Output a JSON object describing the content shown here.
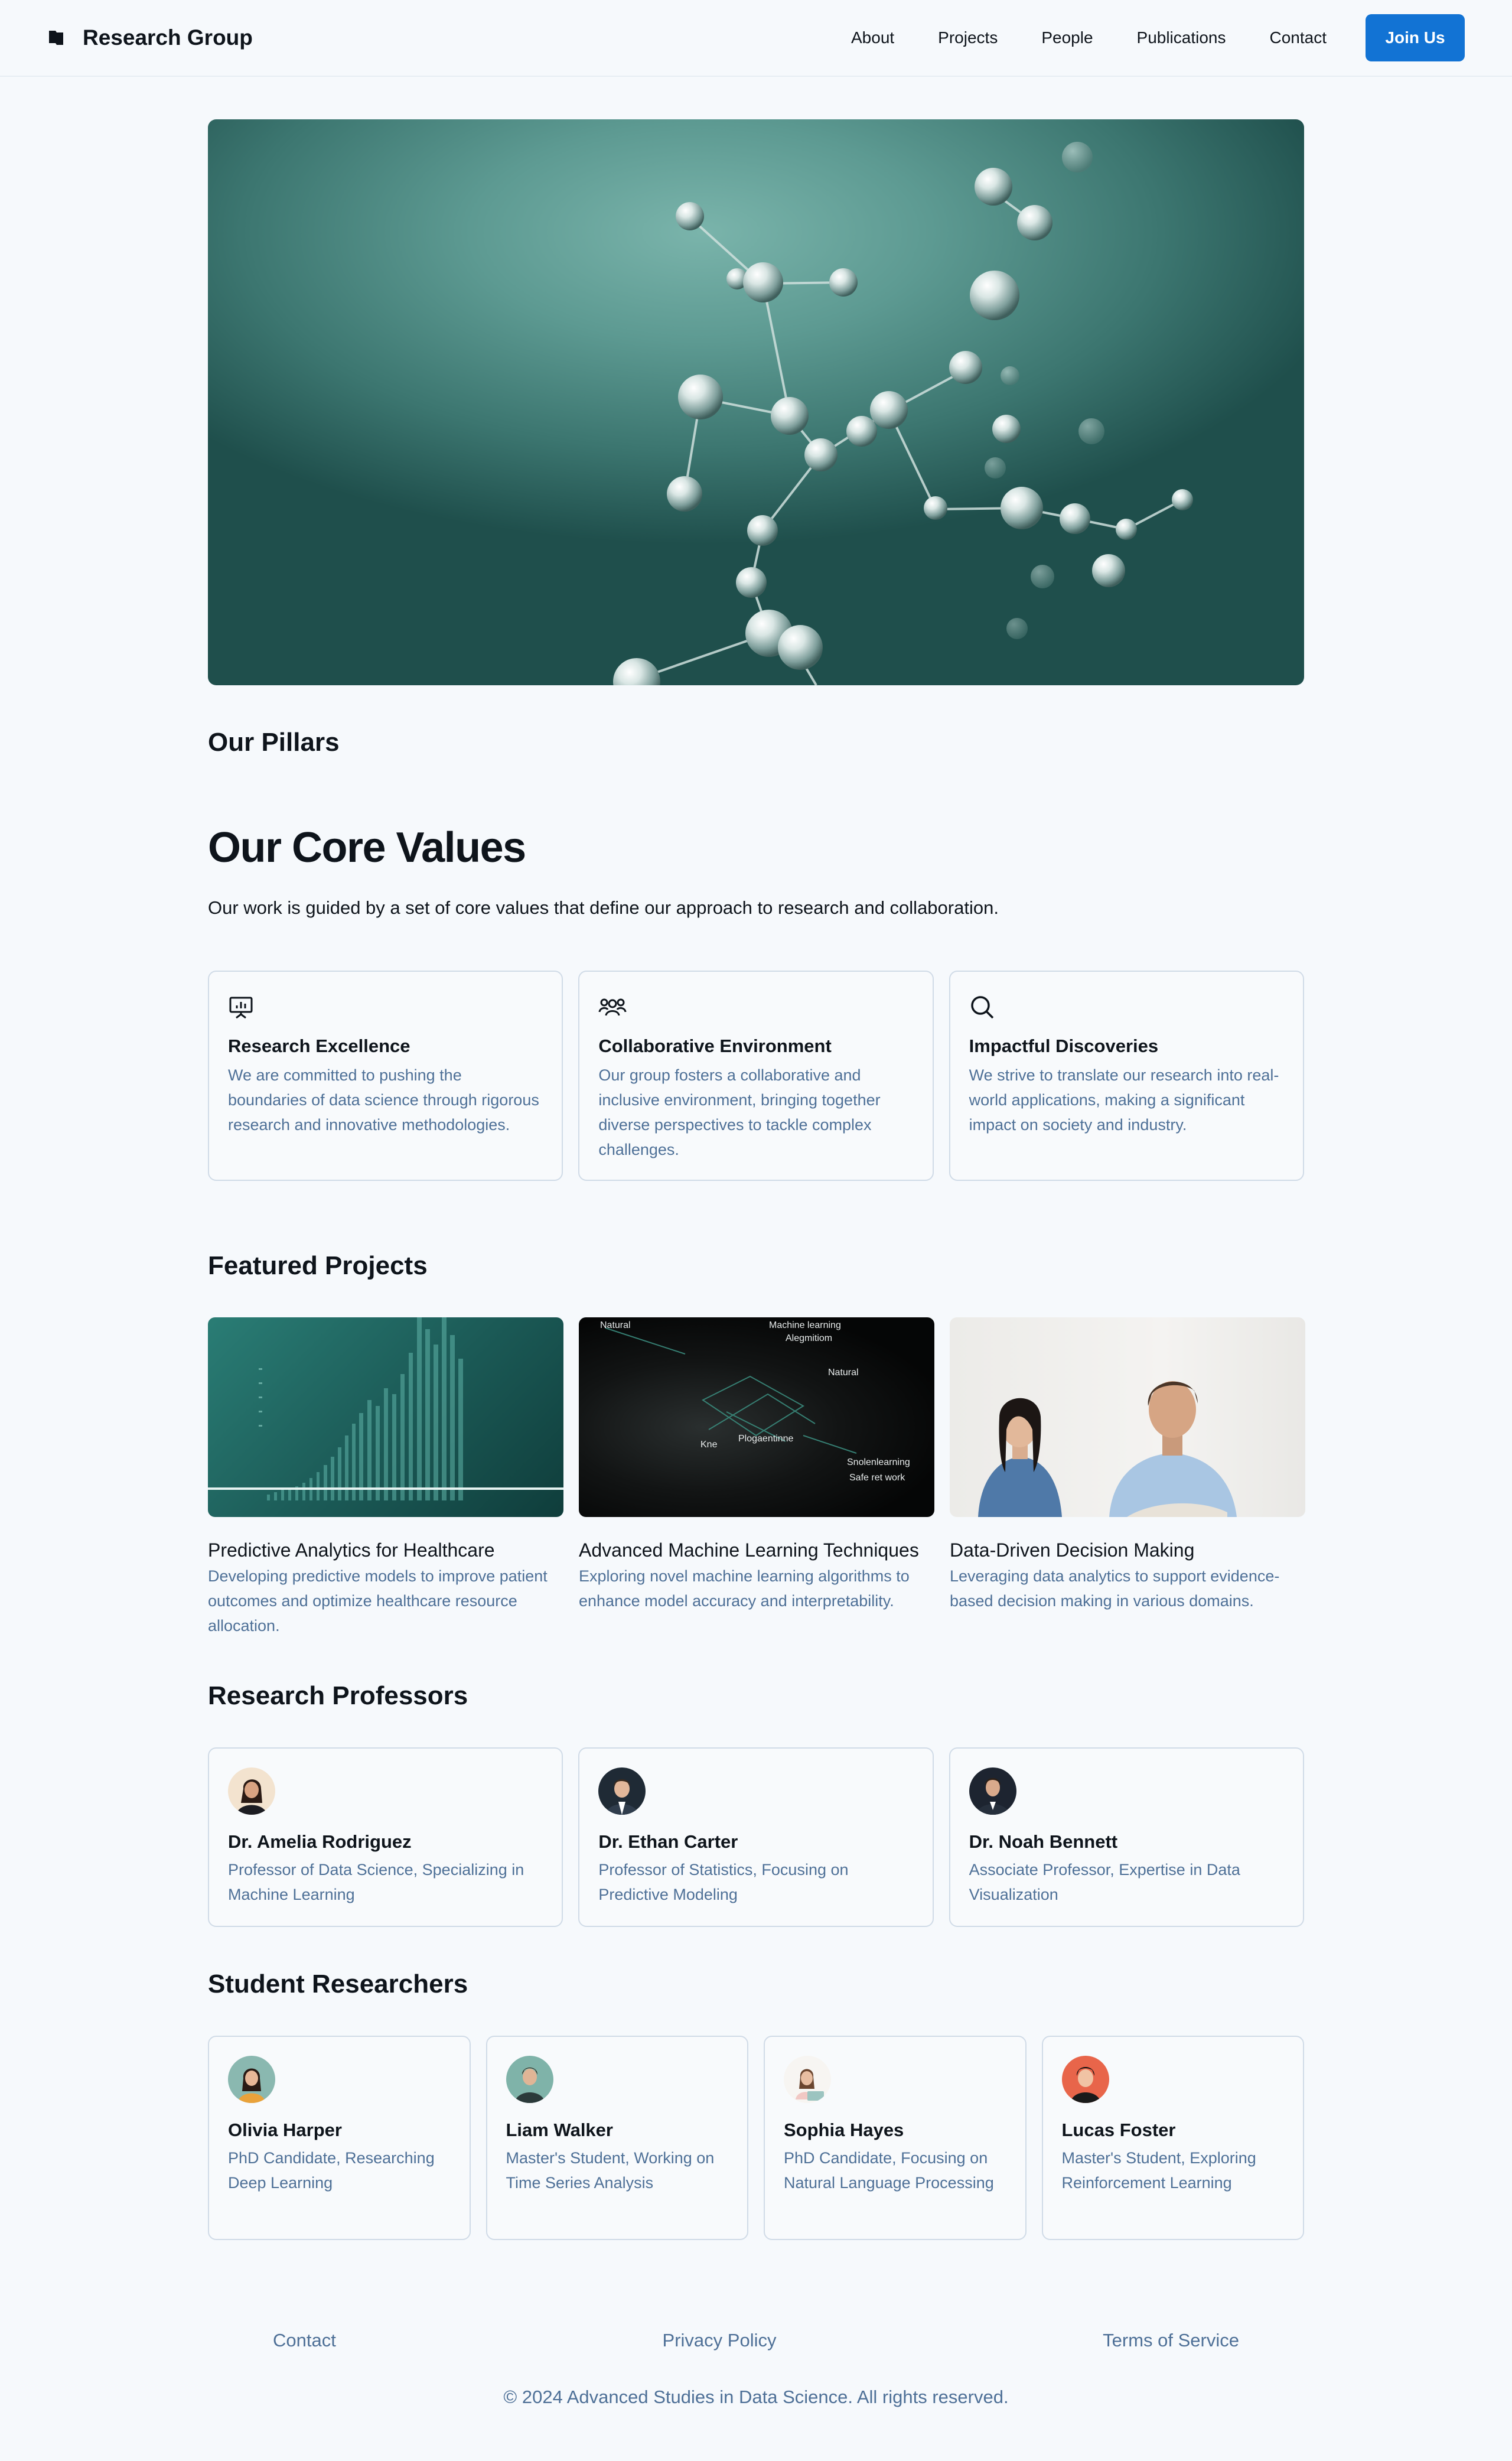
{
  "header": {
    "brand": "Research Group",
    "nav": [
      "About",
      "Projects",
      "People",
      "Publications",
      "Contact"
    ],
    "cta": "Join Us",
    "accent": "#1273d4"
  },
  "pillars": {
    "title": "Our Pillars"
  },
  "core_values": {
    "title": "Our Core Values",
    "description": "Our work is guided by a set of core values that define our approach to research and collaboration.",
    "cards": [
      {
        "icon": "presentation-chart-icon",
        "title": "Research Excellence",
        "text": "We are committed to pushing the boundaries of data science through rigorous research and innovative methodologies."
      },
      {
        "icon": "users-icon",
        "title": "Collaborative Environment",
        "text": "Our group fosters a collaborative and inclusive environment, bringing together diverse perspectives to tackle complex challenges."
      },
      {
        "icon": "magnifying-glass-icon",
        "title": "Impactful Discoveries",
        "text": "We strive to translate our research into real-world applications, making a significant impact on society and industry."
      }
    ]
  },
  "projects": {
    "title": "Featured Projects",
    "items": [
      {
        "title": "Predictive Analytics for Healthcare",
        "text": "Developing predictive models to improve patient outcomes and optimize healthcare resource allocation."
      },
      {
        "title": "Advanced Machine Learning Techniques",
        "text": "Exploring novel machine learning algorithms to enhance model accuracy and interpretability.",
        "image_labels": [
          "Natural",
          "Machine learning",
          "Alegmitiom",
          "Natural",
          "Kne",
          "Plogaentinne",
          "Snolenlearning",
          "Safe ret work"
        ]
      },
      {
        "title": "Data-Driven Decision Making",
        "text": "Leveraging data analytics to support evidence-based decision making in various domains."
      }
    ]
  },
  "professors": {
    "title": "Research Professors",
    "items": [
      {
        "name": "Dr. Amelia Rodriguez",
        "role": "Professor of Data Science, Specializing in Machine Learning"
      },
      {
        "name": "Dr. Ethan Carter",
        "role": "Professor of Statistics, Focusing on Predictive Modeling"
      },
      {
        "name": "Dr. Noah Bennett",
        "role": "Associate Professor, Expertise in Data Visualization"
      }
    ]
  },
  "students": {
    "title": "Student Researchers",
    "items": [
      {
        "name": "Olivia Harper",
        "role": "PhD Candidate, Researching Deep Learning"
      },
      {
        "name": "Liam Walker",
        "role": "Master's Student, Working on Time Series Analysis"
      },
      {
        "name": "Sophia Hayes",
        "role": "PhD Candidate, Focusing on Natural Language Processing"
      },
      {
        "name": "Lucas Foster",
        "role": "Master's Student, Exploring Reinforcement Learning"
      }
    ]
  },
  "footer": {
    "links": [
      "Contact",
      "Privacy Policy",
      "Terms of Service"
    ],
    "copyright": "© 2024 Advanced Studies in Data Science. All rights reserved."
  }
}
